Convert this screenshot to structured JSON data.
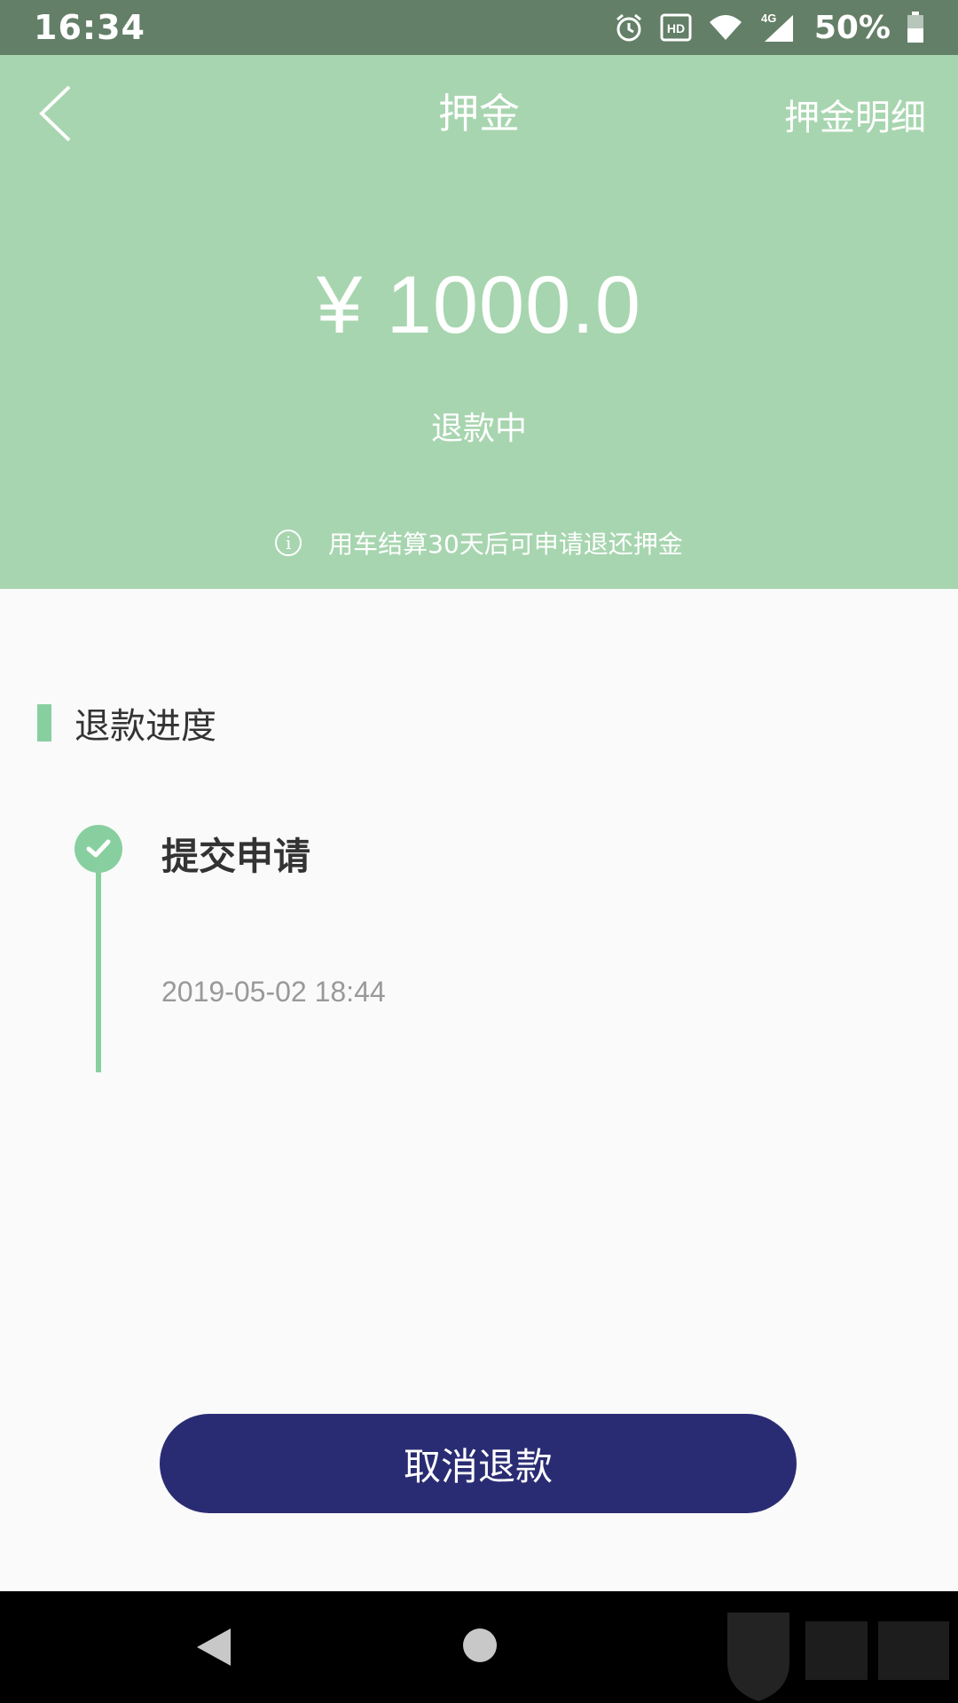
{
  "status_bar": {
    "time": "16:34",
    "icons": [
      "alarm-icon",
      "hd-icon",
      "wifi-icon",
      "signal-4g-icon",
      "battery-icon"
    ],
    "network_label": "4G",
    "hd_label": "HD",
    "battery": "50%"
  },
  "header": {
    "title": "押金",
    "detail_link": "押金明细",
    "amount": "¥ 1000.0",
    "status": "退款中",
    "notice": "用车结算30天后可申请退还押金",
    "back_icon": "chevron-left-icon",
    "info_icon": "info-icon"
  },
  "progress": {
    "section_title": "退款进度",
    "steps": [
      {
        "title": "提交申请",
        "time": "2019-05-02 18:44",
        "icon": "check-circle-icon"
      }
    ]
  },
  "actions": {
    "cancel_label": "取消退款"
  },
  "colors": {
    "status_bar": "#637f67",
    "header": "#a7d5af",
    "accent": "#88cfa0",
    "button": "#2a2c73",
    "background": "#fafafa"
  }
}
